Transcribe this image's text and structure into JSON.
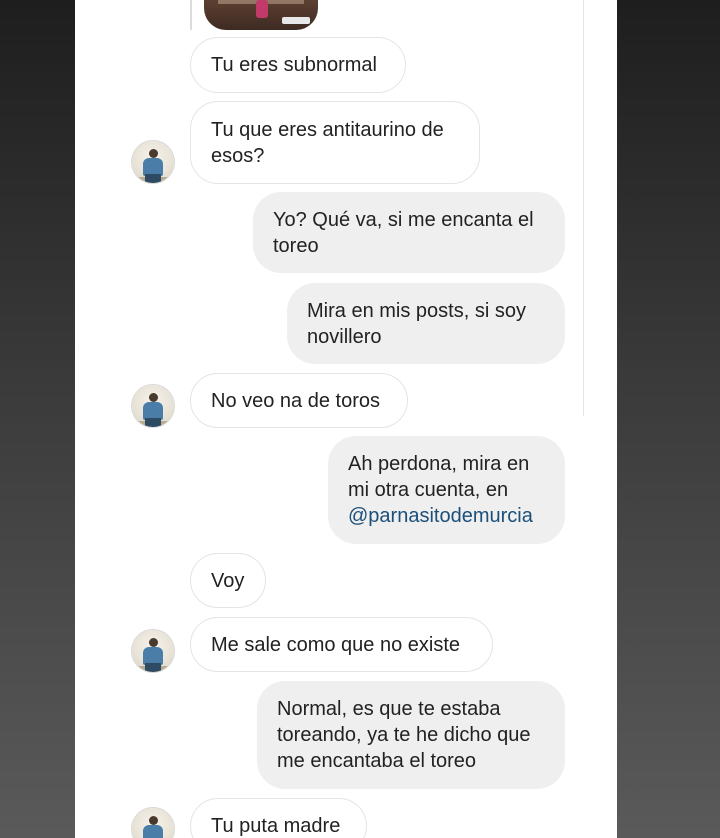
{
  "conversation": {
    "messages": [
      {
        "id": 1,
        "direction": "received",
        "text": "Tu eres subnormal"
      },
      {
        "id": 2,
        "direction": "received",
        "text": "Tu que eres antitaurino de\nesos?"
      },
      {
        "id": 3,
        "direction": "sent",
        "text": "Yo? Qué va, si me encanta el\ntoreo"
      },
      {
        "id": 4,
        "direction": "sent",
        "text": "Mira en mis posts, si soy\nnovillero"
      },
      {
        "id": 5,
        "direction": "received",
        "text": "No veo na de toros"
      },
      {
        "id": 6,
        "direction": "sent",
        "text_before": "Ah perdona, mira en\nmi otra cuenta, en",
        "mention": "@parnasitodemurcia"
      },
      {
        "id": 7,
        "direction": "received",
        "text": "Voy"
      },
      {
        "id": 8,
        "direction": "received",
        "text": "Me sale como que no existe"
      },
      {
        "id": 9,
        "direction": "sent",
        "text": "Normal, es que te estaba\ntoreando, ya te he dicho que\nme encantaba el toreo"
      },
      {
        "id": 10,
        "direction": "received",
        "text": "Tu puta madre"
      }
    ]
  },
  "colors": {
    "received_bubble": "#ffffff",
    "sent_bubble": "#efefef",
    "mention_link": "#1c4f7a",
    "text": "#222222"
  }
}
